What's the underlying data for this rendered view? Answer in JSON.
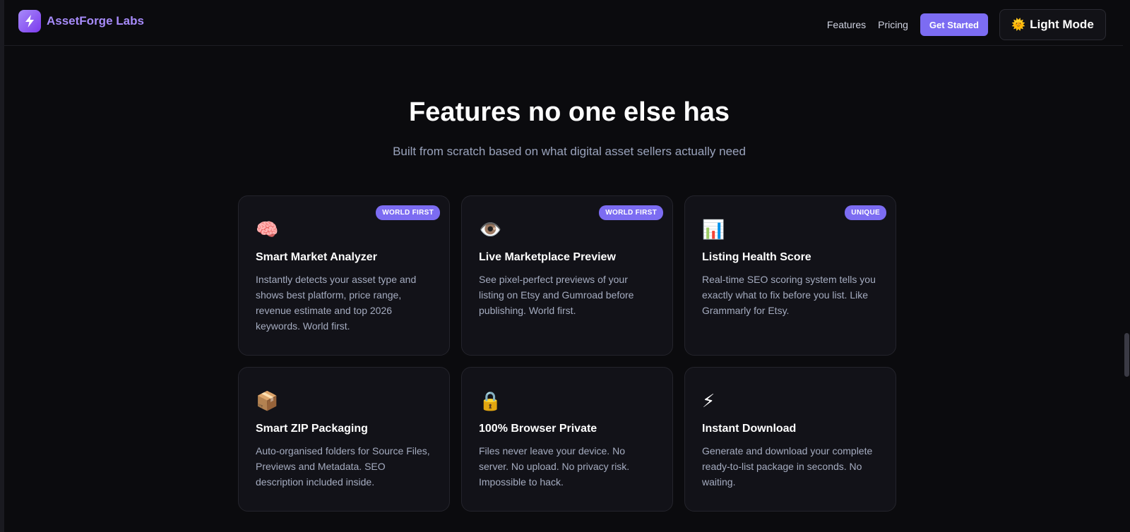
{
  "navbar": {
    "brand_name": "AssetForge Labs",
    "links": [
      "Features",
      "Pricing"
    ],
    "cta_label": "Get Started",
    "mode_toggle_label": "Light Mode"
  },
  "hero": {
    "title": "Features no one else has",
    "subtitle": "Built from scratch based on what digital asset sellers actually need"
  },
  "features": [
    {
      "icon": "🧠",
      "badge": "WORLD FIRST",
      "title": "Smart Market Analyzer",
      "desc": "Instantly detects your asset type and shows best platform, price range, revenue estimate and top 2026 keywords. World first."
    },
    {
      "icon": "👁️",
      "badge": "WORLD FIRST",
      "title": "Live Marketplace Preview",
      "desc": "See pixel-perfect previews of your listing on Etsy and Gumroad before publishing. World first."
    },
    {
      "icon": "📊",
      "badge": "UNIQUE",
      "title": "Listing Health Score",
      "desc": "Real-time SEO scoring system tells you exactly what to fix before you list. Like Grammarly for Etsy."
    },
    {
      "icon": "📦",
      "badge": "",
      "title": "Smart ZIP Packaging",
      "desc": "Auto-organised folders for Source Files, Previews and Metadata. SEO description included inside."
    },
    {
      "icon": "🔒",
      "badge": "",
      "title": "100% Browser Private",
      "desc": "Files never leave your device. No server. No upload. No privacy risk. Impossible to hack."
    },
    {
      "icon": "⚡",
      "badge": "",
      "title": "Instant Download",
      "desc": "Generate and download your complete ready-to-list package in seconds. No waiting."
    }
  ],
  "colors": {
    "accent": "#7c6cf2",
    "brand": "#a78bfa",
    "background": "#0b0b0e",
    "card": "#121218"
  }
}
